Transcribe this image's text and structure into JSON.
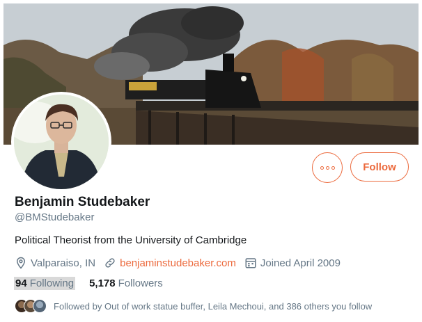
{
  "profile": {
    "name": "Benjamin Studebaker",
    "handle": "@BMStudebaker",
    "bio": "Political Theorist from the University of Cambridge",
    "location": "Valparaiso, IN",
    "website": "benjaminstudebaker.com",
    "joined": "Joined April 2009"
  },
  "actions": {
    "more_icon": "more-icon",
    "follow_label": "Follow"
  },
  "stats": {
    "following_count": "94",
    "following_label": "Following",
    "followers_count": "5,178",
    "followers_label": "Followers"
  },
  "followed_by": {
    "text": "Followed by Out of work statue buffer, Leila Mechoui, and 386 others you follow"
  },
  "colors": {
    "accent": "#ec6a3d",
    "secondary_text": "#657786",
    "primary_text": "#14171a"
  }
}
